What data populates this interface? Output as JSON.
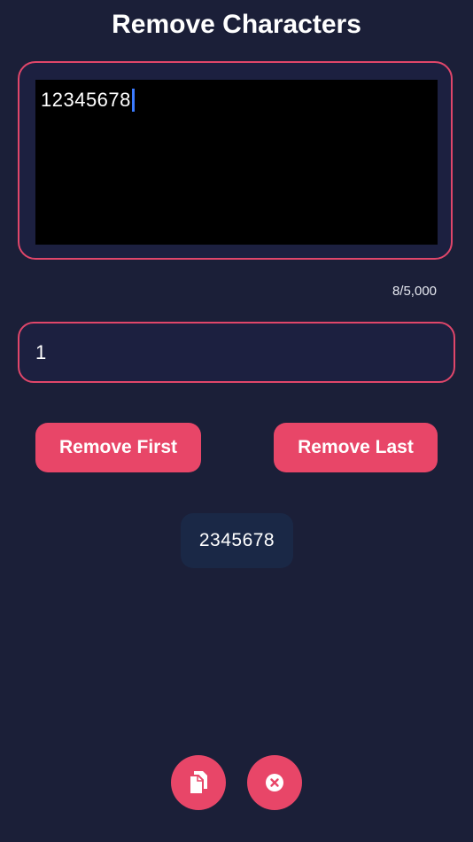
{
  "header": {
    "title": "Remove Characters"
  },
  "input": {
    "text": "12345678",
    "char_count": "8/5,000"
  },
  "count_field": {
    "value": "1"
  },
  "buttons": {
    "remove_first": "Remove First",
    "remove_last": "Remove Last"
  },
  "result": {
    "text": "2345678"
  },
  "actions": {
    "copy_icon": "copy-icon",
    "clear_icon": "clear-icon"
  },
  "colors": {
    "background": "#1b1f38",
    "accent": "#e84668",
    "input_background": "#000000",
    "result_background": "#1a2846",
    "caret": "#3b7bff"
  }
}
